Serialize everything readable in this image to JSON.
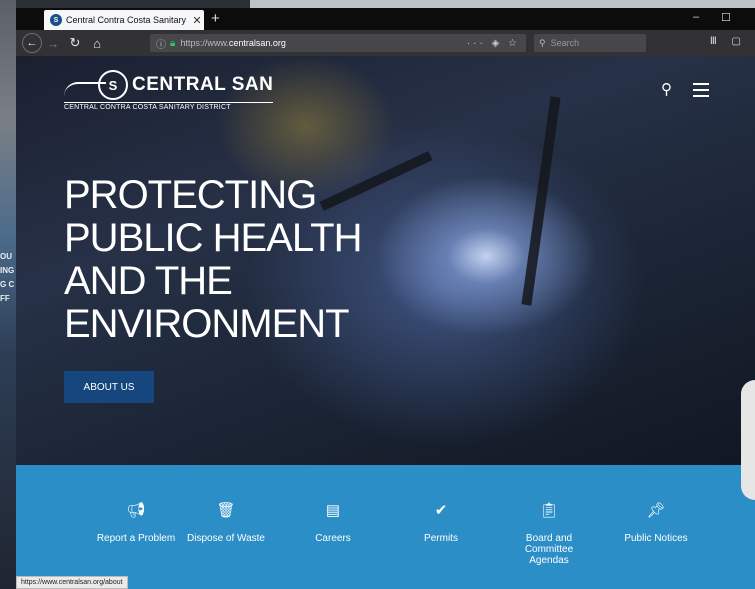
{
  "desktop": {
    "left_fragments": [
      "OU",
      "ING",
      "G C",
      "FF"
    ]
  },
  "browser": {
    "tab_title": "Central Contra Costa Sanitary",
    "url_prefix": "https://www.",
    "url_host": "centralsan.org",
    "search_placeholder": "Search",
    "status_url": "https://www.centralsan.org/about"
  },
  "site": {
    "logo_mark": "S",
    "logo_name": "CENTRAL SAN",
    "logo_sub": "CENTRAL CONTRA COSTA SANITARY DISTRICT",
    "headline_lines": [
      "PROTECTING",
      "PUBLIC HEALTH",
      "AND THE",
      "ENVIRONMENT"
    ],
    "cta": "ABOUT US",
    "quicklinks": [
      {
        "icon": "megaphone-icon",
        "label": "Report a Problem"
      },
      {
        "icon": "trash-icon",
        "label": "Dispose of Waste"
      },
      {
        "icon": "id-card-icon",
        "label": "Careers"
      },
      {
        "icon": "check-circle-icon",
        "label": "Permits"
      },
      {
        "icon": "clipboard-clock-icon",
        "label": "Board and Committee Agendas"
      },
      {
        "icon": "pushpin-icon",
        "label": "Public Notices"
      }
    ]
  },
  "colors": {
    "band": "#2b8ec7",
    "cta": "#15467d"
  }
}
